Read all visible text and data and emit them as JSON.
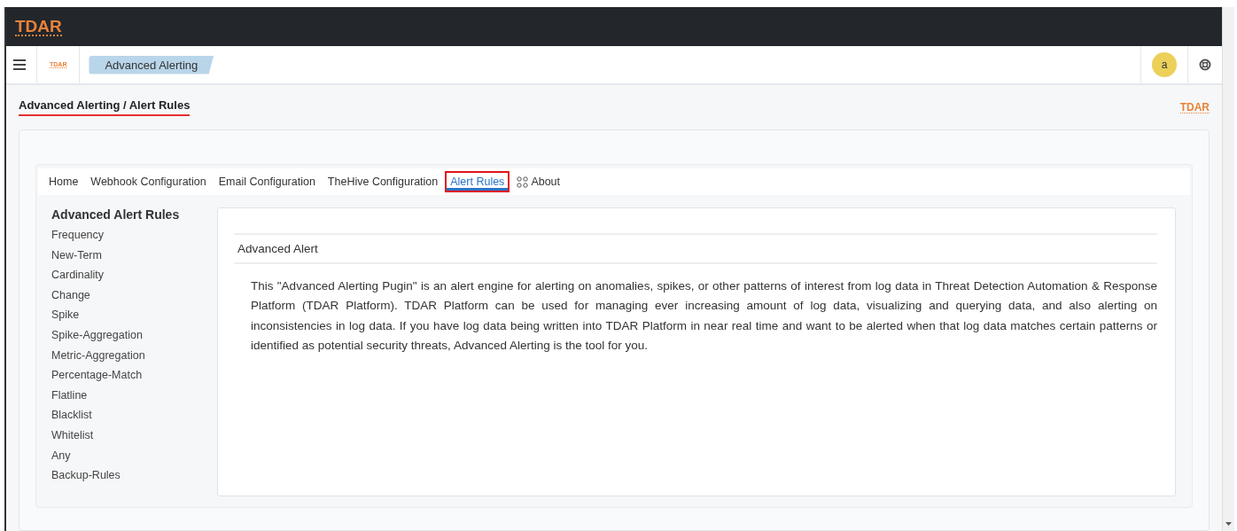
{
  "topbar": {
    "logo": "TDAR"
  },
  "navbar": {
    "logo": "TDAR",
    "app_tab": "Advanced Alerting",
    "avatar": "a"
  },
  "breadcrumb": {
    "text": "Advanced Alerting / Alert Rules",
    "highlighted": true,
    "logo": "TDAR"
  },
  "tabs": [
    {
      "label": "Home",
      "selected": false,
      "highlighted": false
    },
    {
      "label": "Webhook Configuration",
      "selected": false,
      "highlighted": false
    },
    {
      "label": "Email Configuration",
      "selected": false,
      "highlighted": false
    },
    {
      "label": "TheHive Configuration",
      "selected": false,
      "highlighted": false
    },
    {
      "label": "Alert Rules",
      "selected": true,
      "highlighted": true
    },
    {
      "label": "About",
      "selected": false,
      "highlighted": false,
      "kind": "icon"
    }
  ],
  "sidebar": {
    "title": "Advanced Alert Rules",
    "items": [
      "Frequency",
      "New-Term",
      "Cardinality",
      "Change",
      "Spike",
      "Spike-Aggregation",
      "Metric-Aggregation",
      "Percentage-Match",
      "Flatline",
      "Blacklist",
      "Whitelist",
      "Any",
      "Backup-Rules"
    ]
  },
  "content": {
    "heading": "Advanced Alert",
    "body": "This \"Advanced Alerting Pugin\" is an alert engine for alerting on anomalies, spikes, or other patterns of interest from log data in Threat Detection Automation & Response Platform (TDAR Platform). TDAR Platform can be used for managing ever increasing amount of log data, visualizing and querying data, and also alerting on inconsistencies in log data. If you have log data being written into TDAR Platform in near real time and want to be alerted when that log data matches certain patterns or identified as potential security threats, Advanced Alerting is the tool for you."
  }
}
